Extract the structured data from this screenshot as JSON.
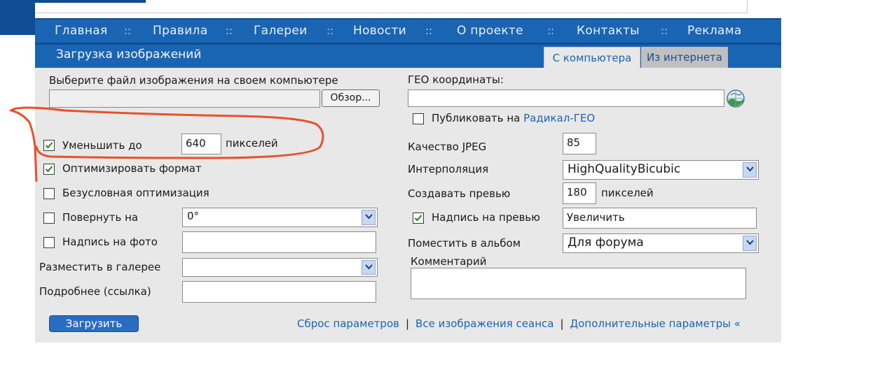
{
  "nav": {
    "items": [
      "Главная",
      "Правила",
      "Галереи",
      "Новости",
      "О проекте",
      "Контакты",
      "Реклама"
    ],
    "separator": "::"
  },
  "upload": {
    "title": "Загрузка изображений",
    "tab_computer": "С компьютера",
    "tab_internet": "Из интернета"
  },
  "left": {
    "file_label": "Выберите файл изображения на своем компьютере",
    "file_value": "",
    "browse_label": "Обзор...",
    "resize_label": "Уменьшить до",
    "resize_value": "640",
    "resize_unit": "пикселей",
    "resize_checked": true,
    "optimize_label": "Оптимизировать формат",
    "optimize_checked": true,
    "force_opt_label": "Безусловная оптимизация",
    "force_opt_checked": false,
    "rotate_label": "Повернуть на",
    "rotate_value": "0°",
    "rotate_checked": false,
    "caption_label": "Надпись на фото",
    "caption_value": "",
    "caption_checked": false,
    "gallery_label": "Разместить в галерее",
    "gallery_value": "",
    "more_label": "Подробнее (ссылка)",
    "more_value": ""
  },
  "right": {
    "geo_label": "ГЕО координаты:",
    "geo_value": "",
    "publish_prefix": "Публиковать на",
    "publish_link": "Радикал-ГЕО",
    "publish_checked": false,
    "jpeg_label": "Качество JPEG",
    "jpeg_value": "85",
    "interp_label": "Интерполяция",
    "interp_value": "HighQualityBicubic",
    "preview_label": "Создавать превью",
    "preview_value": "180",
    "preview_unit": "пикселей",
    "preview_caption_label": "Надпись на превью",
    "preview_caption_value": "Увеличить",
    "preview_caption_checked": true,
    "album_label": "Поместить в альбом",
    "album_value": "Для форума",
    "comment_label": "Комментарий",
    "comment_value": ""
  },
  "footer": {
    "upload_button": "Загрузить",
    "reset_link": "Сброс параметров",
    "session_link": "Все изображения сеанса",
    "extra_link": "Дополнительные параметры «",
    "separator": "|"
  },
  "colors": {
    "nav_bg": "#1a64b4",
    "panel_bg": "#e8e8e8",
    "link": "#1a64b4",
    "annotation": "#e8502a"
  }
}
